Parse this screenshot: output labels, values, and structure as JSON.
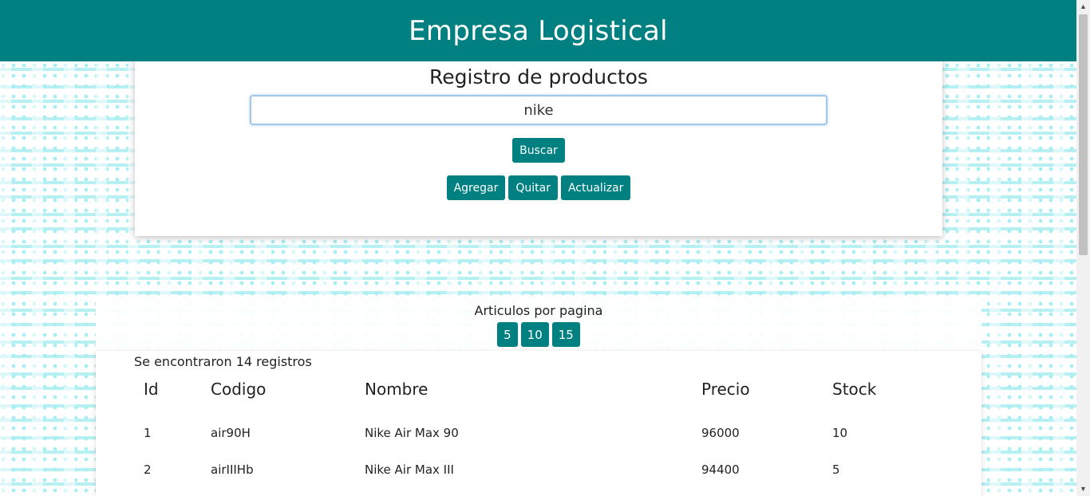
{
  "header": {
    "title": "Empresa Logistical"
  },
  "search": {
    "heading": "Registro de productos",
    "value": "nike",
    "search_label": "Buscar"
  },
  "actions": {
    "add_label": "Agregar",
    "remove_label": "Quitar",
    "update_label": "Actualizar"
  },
  "pagination": {
    "label": "Articulos por pagina",
    "options": [
      "5",
      "10",
      "15"
    ]
  },
  "results": {
    "count_text": "Se encontraron 14 registros",
    "columns": [
      "Id",
      "Codigo",
      "Nombre",
      "Precio",
      "Stock"
    ],
    "rows": [
      [
        "1",
        "air90H",
        "Nike Air Max 90",
        "96000",
        "10"
      ],
      [
        "2",
        "airIIIHb",
        "Nike Air Max III",
        "94400",
        "5"
      ]
    ]
  },
  "colors": {
    "primary": "#008080",
    "pattern": "#a8eef2"
  }
}
